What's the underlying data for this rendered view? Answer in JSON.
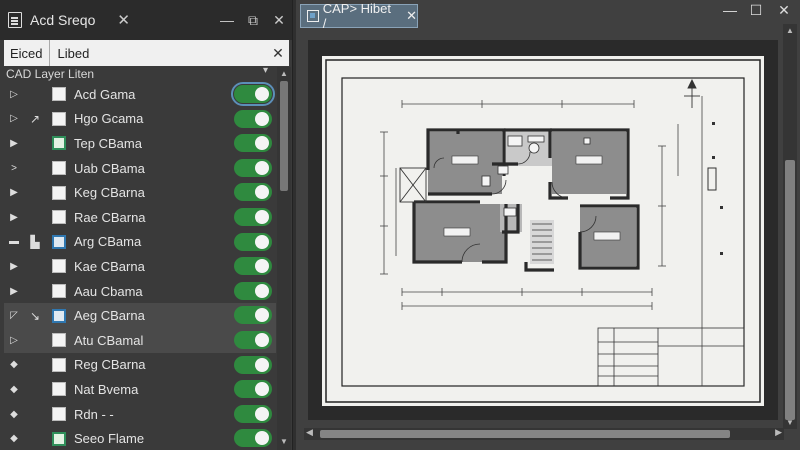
{
  "left_panel": {
    "title": "Acd Sreqo",
    "search": {
      "seg1": "Eiced",
      "seg2": "Libed"
    },
    "list_header": "CAD Layer Liten",
    "layers": [
      {
        "name": "Acd Gama",
        "checkbox": "plain",
        "icon": "",
        "expander": "▷",
        "on": true
      },
      {
        "name": "Hgo Gcama",
        "checkbox": "plain",
        "icon": "cursor-icon",
        "expander": "▷",
        "on": true
      },
      {
        "name": "Tep CBama",
        "checkbox": "green",
        "icon": "",
        "expander": "▶",
        "on": true
      },
      {
        "name": "Uab CBama",
        "checkbox": "plain",
        "icon": "",
        "expander": ">",
        "on": true
      },
      {
        "name": "Keg CBarna",
        "checkbox": "plain",
        "icon": "",
        "expander": "▶",
        "on": true
      },
      {
        "name": "Rae CBarna",
        "checkbox": "plain",
        "icon": "",
        "expander": "▶",
        "on": true
      },
      {
        "name": "Arg CBama",
        "checkbox": "blue",
        "icon": "lock-icon",
        "expander": "▬",
        "on": true
      },
      {
        "name": "Kae CBarna",
        "checkbox": "plain",
        "icon": "",
        "expander": "▶",
        "on": true
      },
      {
        "name": "Aau Cbama",
        "checkbox": "plain",
        "icon": "",
        "expander": "▶",
        "on": true
      },
      {
        "name": "Aeg CBarna",
        "checkbox": "blue",
        "icon": "tool-icon",
        "expander": "◸",
        "on": true,
        "selected": true
      },
      {
        "name": "Atu CBamal",
        "checkbox": "plain",
        "icon": "",
        "expander": "▷",
        "on": true,
        "selected": true
      },
      {
        "name": "Reg CBarna",
        "checkbox": "plain",
        "icon": "",
        "expander": "◆",
        "on": true
      },
      {
        "name": "Nat Bvema",
        "checkbox": "plain",
        "icon": "",
        "expander": "◆",
        "on": true
      },
      {
        "name": "Rdn - -",
        "checkbox": "plain",
        "icon": "",
        "expander": "◆",
        "on": true
      },
      {
        "name": "Seeo Flame",
        "checkbox": "green",
        "icon": "",
        "expander": "◆",
        "on": true
      }
    ]
  },
  "right_panel": {
    "tab_label": "CAP> Hibet /",
    "window_controls": [
      "—",
      "☐",
      "✕"
    ],
    "drawing": {
      "title_block_rows": 5
    }
  },
  "colors": {
    "toggle_on": "#2f8a3f",
    "tab_bg": "#5a6e7e",
    "room_fill": "#8d8d8d",
    "wall": "#2a2a2a"
  }
}
